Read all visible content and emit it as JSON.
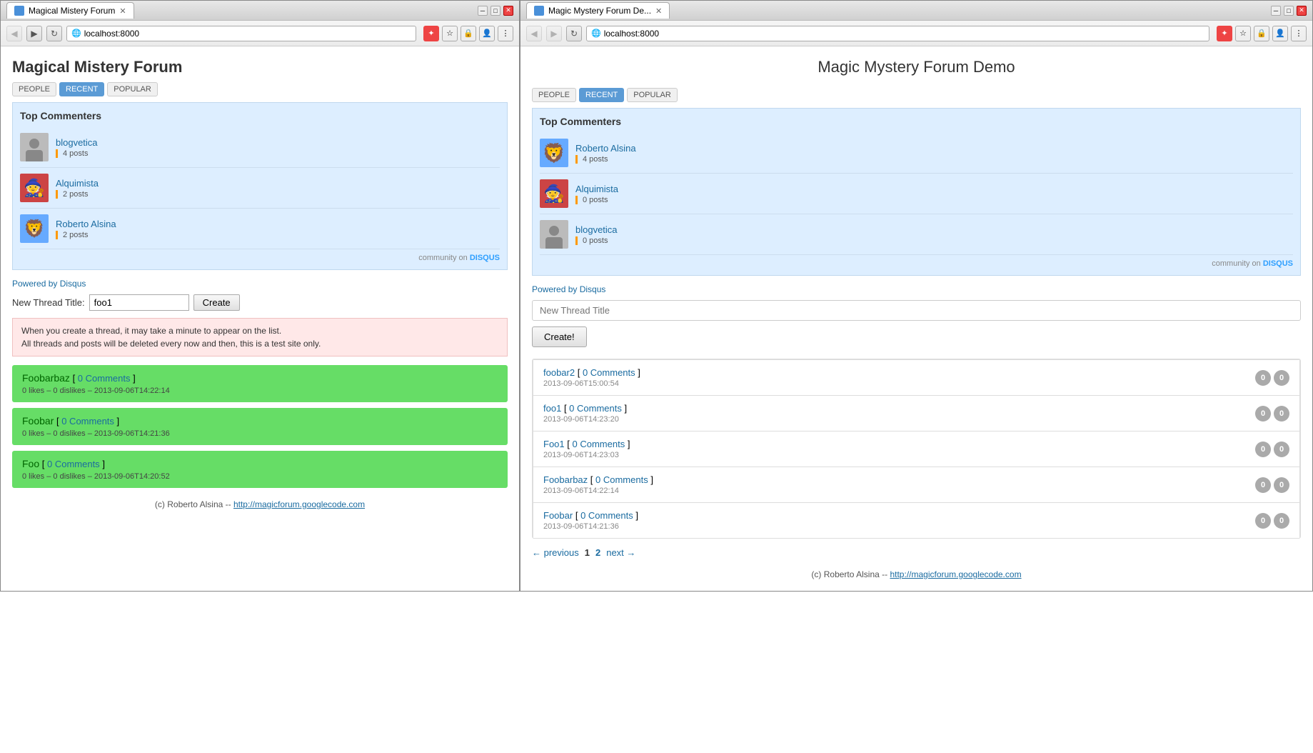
{
  "leftBrowser": {
    "tab": "Magical Mistery Forum",
    "url": "localhost:8000",
    "title": "Magical Mistery Forum",
    "tabs": [
      {
        "label": "PEOPLE",
        "active": false
      },
      {
        "label": "RECENT",
        "active": true
      },
      {
        "label": "POPULAR",
        "active": false
      }
    ],
    "topCommenters": {
      "heading": "Top Commenters",
      "commenters": [
        {
          "name": "blogvetica",
          "posts": "4 posts",
          "avatarType": "person"
        },
        {
          "name": "Alquimista",
          "posts": "2 posts",
          "avatarType": "alquimista"
        },
        {
          "name": "Roberto Alsina",
          "posts": "2 posts",
          "avatarType": "roberto"
        }
      ],
      "communityLine": "community on"
    },
    "poweredLink": "Powered by Disqus",
    "newThread": {
      "label": "New Thread Title:",
      "placeholder": "foo1",
      "buttonLabel": "Create"
    },
    "warning": {
      "line1": "When you create a thread, it may take a minute to appear on the list.",
      "line2": "All threads and posts will be deleted every now and then, this is a test site only."
    },
    "threads": [
      {
        "title": "Foobarbaz",
        "comments": "0 Comments",
        "meta": "0 likes – 0 dislikes – 2013-09-06T14:22:14"
      },
      {
        "title": "Foobar",
        "comments": "0 Comments",
        "meta": "0 likes – 0 dislikes – 2013-09-06T14:21:36"
      },
      {
        "title": "Foo",
        "comments": "0 Comments",
        "meta": "0 likes – 0 dislikes – 2013-09-06T14:20:52"
      }
    ],
    "footer": "(c) Roberto Alsina --",
    "footerLink": "http://magicforum.googlecode.com"
  },
  "rightBrowser": {
    "tab": "Magic Mystery Forum De...",
    "url": "localhost:8000",
    "title": "Magic Mystery Forum Demo",
    "tabs": [
      {
        "label": "PEOPLE",
        "active": false
      },
      {
        "label": "RECENT",
        "active": true
      },
      {
        "label": "POPULAR",
        "active": false
      }
    ],
    "topCommenters": {
      "heading": "Top Commenters",
      "commenters": [
        {
          "name": "Roberto Alsina",
          "posts": "4 posts",
          "avatarType": "roberto"
        },
        {
          "name": "Alquimista",
          "posts": "0 posts",
          "avatarType": "alquimista"
        },
        {
          "name": "blogvetica",
          "posts": "0 posts",
          "avatarType": "person"
        }
      ],
      "communityLine": "community on"
    },
    "poweredLink": "Powered by Disqus",
    "newThread": {
      "placeholder": "New Thread Title",
      "buttonLabel": "Create!"
    },
    "threads": [
      {
        "title": "foobar2",
        "comments": "0 Comments",
        "timestamp": "2013-09-06T15:00:54"
      },
      {
        "title": "foo1",
        "comments": "0 Comments",
        "timestamp": "2013-09-06T14:23:20"
      },
      {
        "title": "Foo1",
        "comments": "0 Comments",
        "timestamp": "2013-09-06T14:23:03"
      },
      {
        "title": "Foobarbaz",
        "comments": "0 Comments",
        "timestamp": "2013-09-06T14:22:14"
      },
      {
        "title": "Foobar",
        "comments": "0 Comments",
        "timestamp": "2013-09-06T14:21:36"
      }
    ],
    "pagination": {
      "prev": "← previous",
      "page1": "1",
      "page2": "2",
      "next": "next →"
    },
    "footer": "(c) Roberto Alsina --",
    "footerLink": "http://magicforum.googlecode.com"
  }
}
